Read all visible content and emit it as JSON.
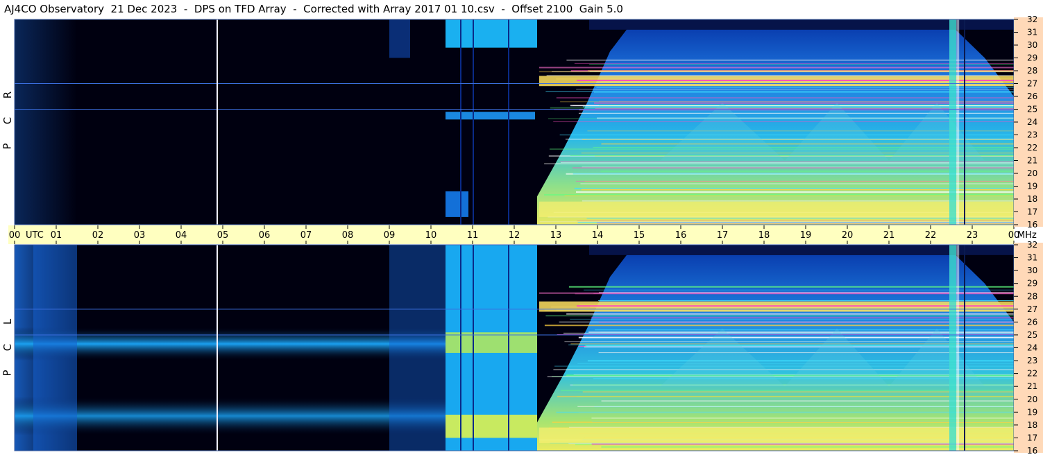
{
  "title": "AJ4CO Observatory  21 Dec 2023  -  DPS on TFD Array  -  Corrected with Array 2017 01 10.csv  -  Offset 2100  Gain 5.0",
  "panels": [
    {
      "id": "rcp",
      "letters": [
        "R",
        "C",
        "P"
      ]
    },
    {
      "id": "lcp",
      "letters": [
        "L",
        "C",
        "P"
      ]
    }
  ],
  "time_axis": {
    "ticks": [
      "00",
      "01",
      "02",
      "03",
      "04",
      "05",
      "06",
      "07",
      "08",
      "09",
      "10",
      "11",
      "12",
      "13",
      "14",
      "15",
      "16",
      "17",
      "18",
      "19",
      "20",
      "21",
      "22",
      "23",
      "00"
    ],
    "unit": "UTC",
    "freq_unit": "MHz"
  },
  "colors": {
    "background_dark": "#000010",
    "axis_strip": "#ffffc0",
    "freq_strip": "#ffd9b8",
    "grid": "#3b6fe0",
    "white_line": "#f0f0ff"
  },
  "chart_data": {
    "type": "heatmap",
    "title": "AJ4CO Observatory  21 Dec 2023  -  DPS on TFD Array  -  Corrected with Array 2017 01 10.csv  -  Offset 2100  Gain 5.0",
    "xlabel": "UTC",
    "ylabel": "MHz",
    "x_range": [
      0,
      24
    ],
    "y_range": [
      16,
      32
    ],
    "y_ticks": [
      16,
      17,
      18,
      19,
      20,
      21,
      22,
      23,
      24,
      25,
      26,
      27,
      28,
      29,
      30,
      31,
      32
    ],
    "series": [
      {
        "name": "RCP"
      },
      {
        "name": "LCP"
      }
    ],
    "grid_mhz": [
      25,
      27,
      32
    ],
    "white_line_utc": [
      4.85,
      22.8
    ]
  }
}
